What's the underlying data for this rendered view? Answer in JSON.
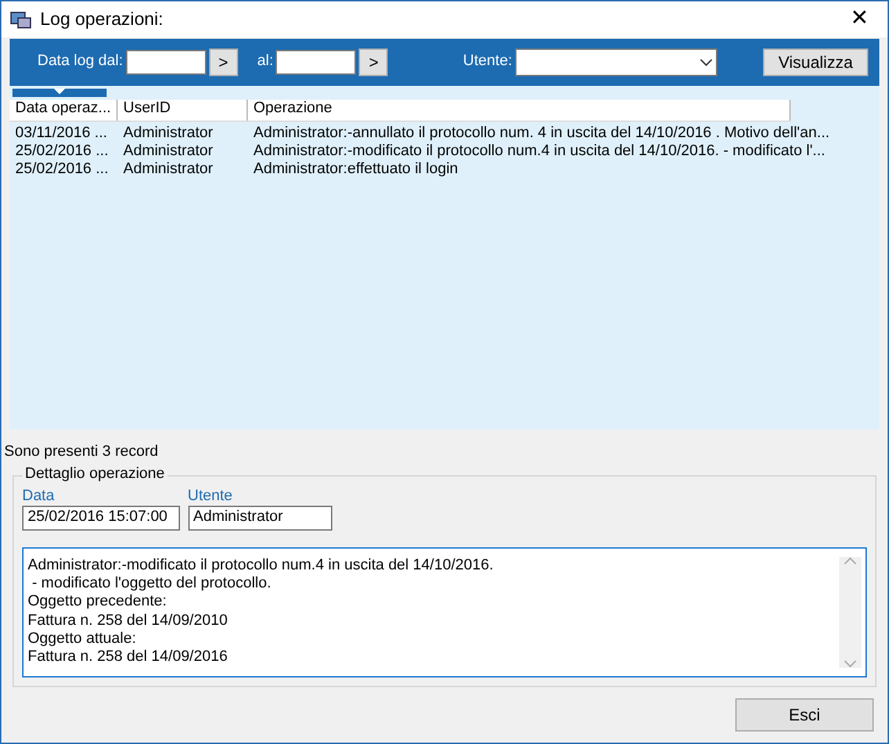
{
  "window": {
    "title": "Log operazioni:",
    "close": "✕"
  },
  "filter": {
    "from_label": "Data log dal:",
    "to_label": "al:",
    "user_label": "Utente:",
    "pick_button": ">",
    "view_button": "Visualizza"
  },
  "table": {
    "columns": [
      "Data operaz...",
      "UserID",
      "Operazione"
    ],
    "rows": [
      [
        "03/11/2016 ...",
        "Administrator",
        "Administrator:-annullato il protocollo num. 4 in uscita del 14/10/2016 . Motivo dell'an..."
      ],
      [
        "25/02/2016 ...",
        "Administrator",
        "Administrator:-modificato il protocollo num.4 in uscita del 14/10/2016. - modificato l'..."
      ],
      [
        "25/02/2016 ...",
        "Administrator",
        "Administrator:effettuato il login"
      ]
    ]
  },
  "status": "Sono presenti 3 record",
  "detail": {
    "title": "Dettaglio operazione",
    "date_label": "Data",
    "date_value": "25/02/2016 15:07:00",
    "user_label": "Utente",
    "user_value": "Administrator",
    "text": "Administrator:-modificato il protocollo num.4 in uscita del 14/10/2016.\n - modificato l'oggetto del protocollo.\nOggetto precedente:\nFattura n. 258 del 14/09/2010\nOggetto attuale:\nFattura n. 258 del 14/09/2016"
  },
  "buttons": [
    "Esci"
  ]
}
